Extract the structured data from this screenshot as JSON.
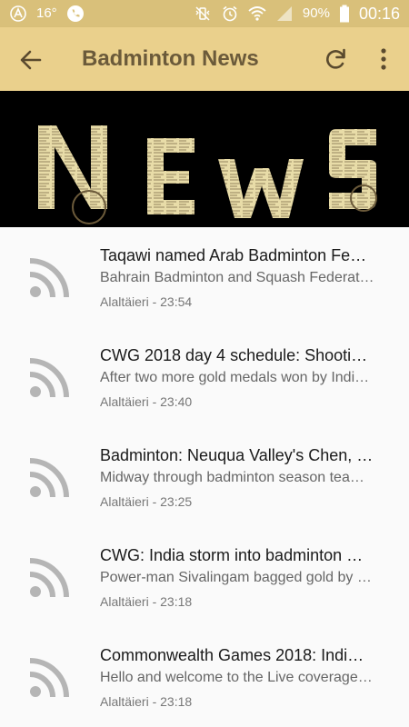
{
  "status_bar": {
    "temperature": "16°",
    "battery": "90%",
    "time": "00:16"
  },
  "app_bar": {
    "title": "Badminton News"
  },
  "banner": {
    "word": "NEWS"
  },
  "news": [
    {
      "title": "Taqawi named Arab Badminton Fe…",
      "desc": "Bahrain Badminton and Squash Federat…",
      "time": "Alaltäieri - 23:54"
    },
    {
      "title": "CWG 2018 day 4 schedule: Shooti…",
      "desc": "After two more gold medals won by Indi…",
      "time": "Alaltäieri - 23:40"
    },
    {
      "title": "Badminton: Neuqua Valley's Chen, …",
      "desc": "Midway through badminton season tea…",
      "time": "Alaltäieri - 23:25"
    },
    {
      "title": "CWG: India storm into badminton …",
      "desc": "Power-man Sivalingam bagged gold by …",
      "time": "Alaltäieri - 23:18"
    },
    {
      "title": "Commonwealth Games 2018: Indi…",
      "desc": "Hello and welcome to the Live coverage…",
      "time": "Alaltäieri - 23:18"
    }
  ],
  "colors": {
    "status_bar": "#d9c07a",
    "app_bar": "#ead08c",
    "title_text": "#6b5a3a",
    "feed_icon": "#b5b5b5"
  }
}
